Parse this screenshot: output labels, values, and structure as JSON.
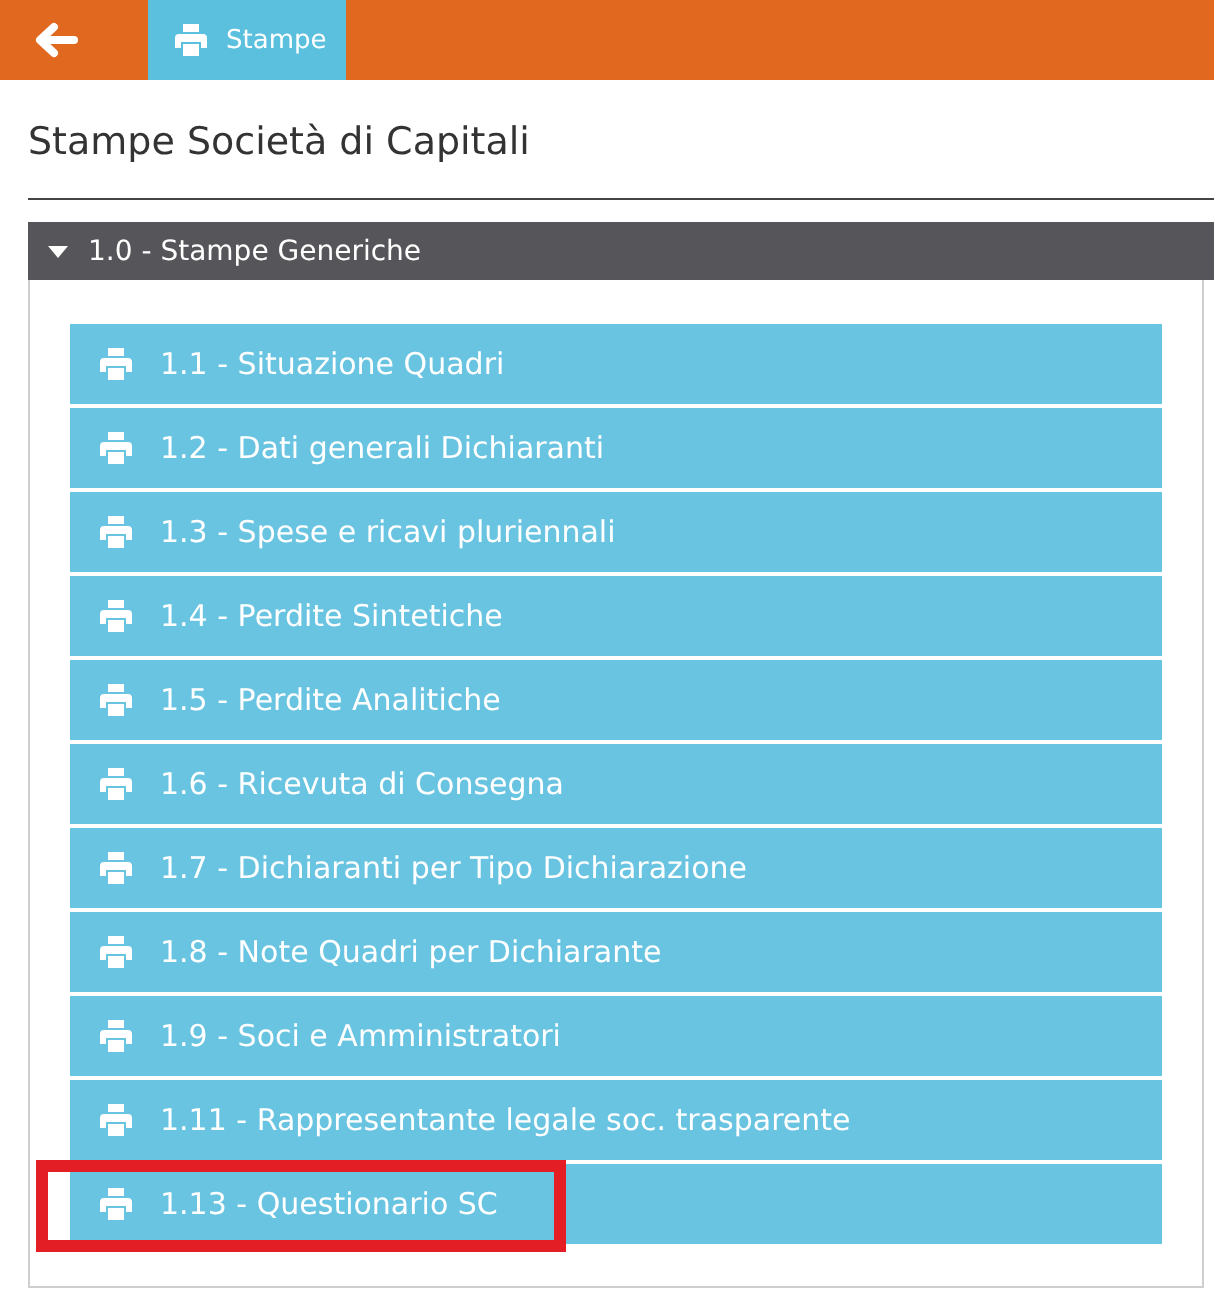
{
  "top_bar": {
    "tabs": [
      {
        "label": "Stampe",
        "selected": true
      }
    ]
  },
  "page_title": "Stampe Società di Capitali",
  "section": {
    "title": "1.0 - Stampe Generiche",
    "expanded": true,
    "items": [
      {
        "label": "1.1 - Situazione Quadri",
        "highlighted": false
      },
      {
        "label": "1.2 - Dati generali Dichiaranti",
        "highlighted": false
      },
      {
        "label": "1.3 - Spese e ricavi pluriennali",
        "highlighted": false
      },
      {
        "label": "1.4 - Perdite Sintetiche",
        "highlighted": false
      },
      {
        "label": "1.5 - Perdite Analitiche",
        "highlighted": false
      },
      {
        "label": "1.6 - Ricevuta di Consegna",
        "highlighted": false
      },
      {
        "label": "1.7 - Dichiaranti per Tipo Dichiarazione",
        "highlighted": false
      },
      {
        "label": "1.8 - Note Quadri per Dichiarante",
        "highlighted": false
      },
      {
        "label": "1.9 - Soci e Amministratori",
        "highlighted": false
      },
      {
        "label": "1.11 - Rappresentante legale soc. trasparente",
        "highlighted": false
      },
      {
        "label": "1.13 - Questionario SC",
        "highlighted": true
      }
    ]
  }
}
